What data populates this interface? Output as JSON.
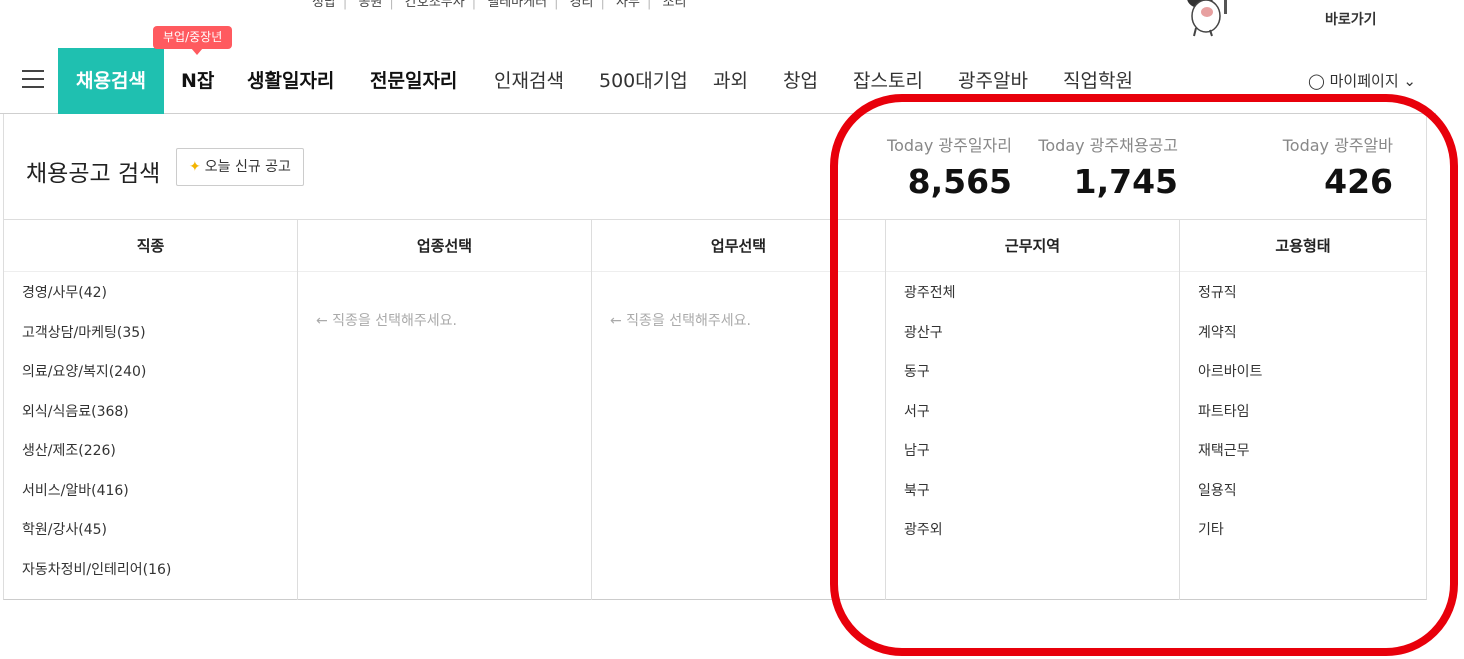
{
  "top_links": [
    "정답",
    "공원",
    "간호조무사",
    "텔레마케터",
    "경리",
    "사무",
    "조리"
  ],
  "shortcut_label": "바로가기",
  "nav": {
    "badge": "부업/중장년",
    "items": [
      "채용검색",
      "N잡",
      "생활일자리",
      "전문일자리",
      "인재검색",
      "500대기업",
      "과외",
      "창업",
      "잡스토리",
      "광주알바",
      "직업학원"
    ],
    "mypage": "마이페이지"
  },
  "search": {
    "title": "채용공고 검색",
    "today_button": "오늘 신규 공고"
  },
  "stats": [
    {
      "label": "Today 광주일자리",
      "value": "8,565"
    },
    {
      "label": "Today 광주채용공고",
      "value": "1,745"
    },
    {
      "label": "Today 광주알바",
      "value": "426"
    }
  ],
  "columns": {
    "job_type": {
      "header": "직종",
      "items": [
        "경영/사무(42)",
        "고객상담/마케팅(35)",
        "의료/요양/복지(240)",
        "외식/식음료(368)",
        "생산/제조(226)",
        "서비스/알바(416)",
        "학원/강사(45)",
        "자동차정비/인테리어(16)"
      ]
    },
    "industry": {
      "header": "업종선택",
      "placeholder": "← 직종을 선택해주세요."
    },
    "task": {
      "header": "업무선택",
      "placeholder": "← 직종을 선택해주세요."
    },
    "region": {
      "header": "근무지역",
      "items": [
        "광주전체",
        "광산구",
        "동구",
        "서구",
        "남구",
        "북구",
        "광주외"
      ]
    },
    "employment": {
      "header": "고용형태",
      "items": [
        "정규직",
        "계약직",
        "아르바이트",
        "파트타임",
        "재택근무",
        "일용직",
        "기타"
      ]
    }
  },
  "colors": {
    "accent": "#1fc0b0",
    "badge": "#ff5a5f",
    "highlight": "#e8000b"
  }
}
